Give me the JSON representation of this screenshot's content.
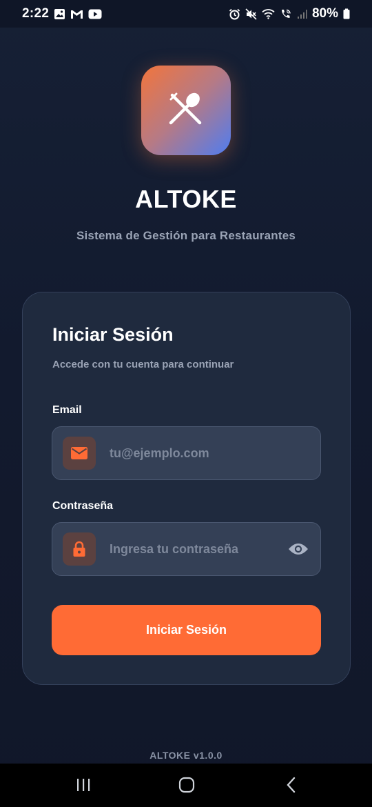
{
  "status_bar": {
    "time": "2:22",
    "battery": "80%",
    "left_icons": [
      "image-icon",
      "gmail-icon",
      "youtube-icon"
    ],
    "right_icons": [
      "alarm-icon",
      "mute-icon",
      "wifi-icon",
      "wifi-calling-icon",
      "signal-icon",
      "battery-icon"
    ]
  },
  "app": {
    "name": "ALTOKE",
    "tagline": "Sistema de Gestión para Restaurantes",
    "logo_icon": "utensils-icon",
    "version": "ALTOKE v1.0.0"
  },
  "login_card": {
    "title": "Iniciar Sesión",
    "subtitle": "Accede con tu cuenta para continuar",
    "email": {
      "label": "Email",
      "value": "",
      "placeholder": "tu@ejemplo.com",
      "icon": "mail-icon"
    },
    "password": {
      "label": "Contraseña",
      "value": "",
      "placeholder": "Ingresa tu contraseña",
      "icon": "lock-icon",
      "toggle_icon": "eye-icon"
    },
    "submit_label": "Iniciar Sesión"
  },
  "colors": {
    "accent": "#ff6b35",
    "background": "#121a2e",
    "card": "#1f2a3e",
    "input": "#344056",
    "muted_text": "#9aa3b5"
  },
  "nav_bar": {
    "icons": [
      "recents-icon",
      "home-icon",
      "back-icon"
    ]
  }
}
